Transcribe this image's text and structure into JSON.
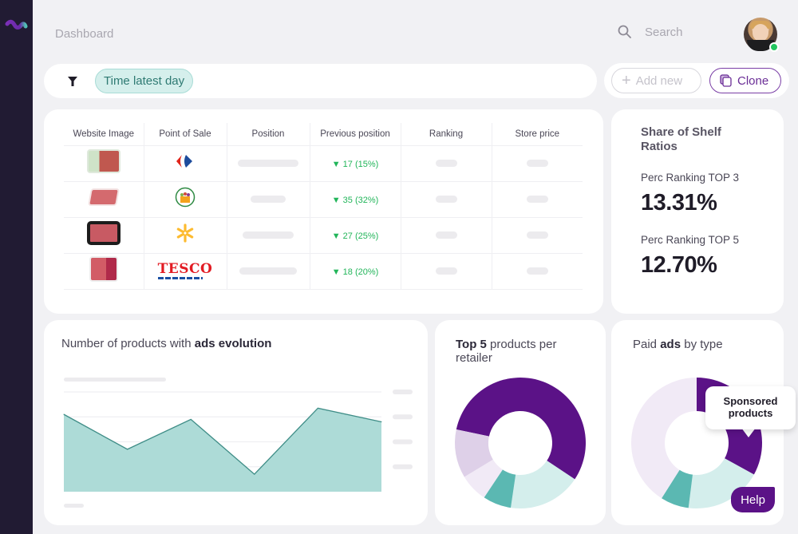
{
  "app": {
    "breadcrumb": "Dashboard",
    "search_placeholder": "Search",
    "user": {
      "online": true
    }
  },
  "filters": {
    "chips": [
      {
        "label": "Time latest day"
      }
    ]
  },
  "actions": {
    "add_new_label": "Add new",
    "clone_label": "Clone"
  },
  "table": {
    "columns": [
      "Website Image",
      "Point of Sale",
      "Position",
      "Previous position",
      "Ranking",
      "Store price"
    ],
    "rows": [
      {
        "image": "minced-meat-bio-pack",
        "retailer": "Carrefour",
        "previous_position": "17 (15%)",
        "trend": "down"
      },
      {
        "image": "minced-meat-tray",
        "retailer": "Supermarket basket",
        "previous_position": "35 (32%)",
        "trend": "down"
      },
      {
        "image": "minced-meat-black-tray",
        "retailer": "Walmart",
        "previous_position": "27 (25%)",
        "trend": "down"
      },
      {
        "image": "minced-meat-5-days-pack",
        "retailer": "Tesco",
        "previous_position": "18 (20%)",
        "trend": "down"
      }
    ],
    "retailer_logos": {
      "tesco_text": "TESCO"
    }
  },
  "share_of_shelf": {
    "title": "Share of Shelf Ratios",
    "metrics": [
      {
        "label": "Perc Ranking TOP 3",
        "value": "13.31%"
      },
      {
        "label": "Perc Ranking TOP 5",
        "value": "12.70%"
      }
    ]
  },
  "cards": {
    "area_title_prefix": "Number of products with ",
    "area_title_bold": "ads evolution",
    "donut1_title_bold": "Top 5",
    "donut1_title_rest": " products per retailer",
    "donut2_title_prefix": "Paid ",
    "donut2_title_bold": "ads",
    "donut2_title_rest": " by type"
  },
  "tooltip": {
    "text": "Sponsored products"
  },
  "help_label": "Help",
  "colors": {
    "brand_purple": "#5b1287",
    "teal": "#5bb8b2",
    "light_teal": "#d4eeec",
    "lavender": "#ded0e8",
    "pale_lavender": "#f1eaf6",
    "positive_green": "#22b55a"
  },
  "chart_data": [
    {
      "type": "area",
      "title": "Number of products with ads evolution",
      "xlabel": "",
      "ylabel": "",
      "x": [
        1,
        2,
        3,
        4,
        5,
        6
      ],
      "values": [
        3.1,
        1.7,
        2.9,
        0.7,
        3.35,
        2.8
      ],
      "ylim": [
        0,
        4
      ],
      "grid": true,
      "tick_labels": "hidden (skeleton placeholders)"
    },
    {
      "type": "pie",
      "title": "Top 5 products per retailer",
      "donut": true,
      "slices": [
        {
          "name": "segment-1",
          "value": 56,
          "color": "#5b1287"
        },
        {
          "name": "segment-2",
          "value": 18,
          "color": "#d4eeec"
        },
        {
          "name": "segment-3",
          "value": 7,
          "color": "#5bb8b2"
        },
        {
          "name": "segment-4",
          "value": 7,
          "color": "#f1eaf6"
        },
        {
          "name": "segment-5",
          "value": 12,
          "color": "#ded0e8"
        }
      ]
    },
    {
      "type": "pie",
      "title": "Paid ads by type",
      "donut": true,
      "slices": [
        {
          "name": "Sponsored products",
          "value": 33,
          "color": "#5b1287"
        },
        {
          "name": "segment-2",
          "value": 19,
          "color": "#d4eeec"
        },
        {
          "name": "segment-3",
          "value": 7,
          "color": "#5bb8b2"
        },
        {
          "name": "segment-4",
          "value": 41,
          "color": "#f1eaf6"
        }
      ]
    }
  ]
}
